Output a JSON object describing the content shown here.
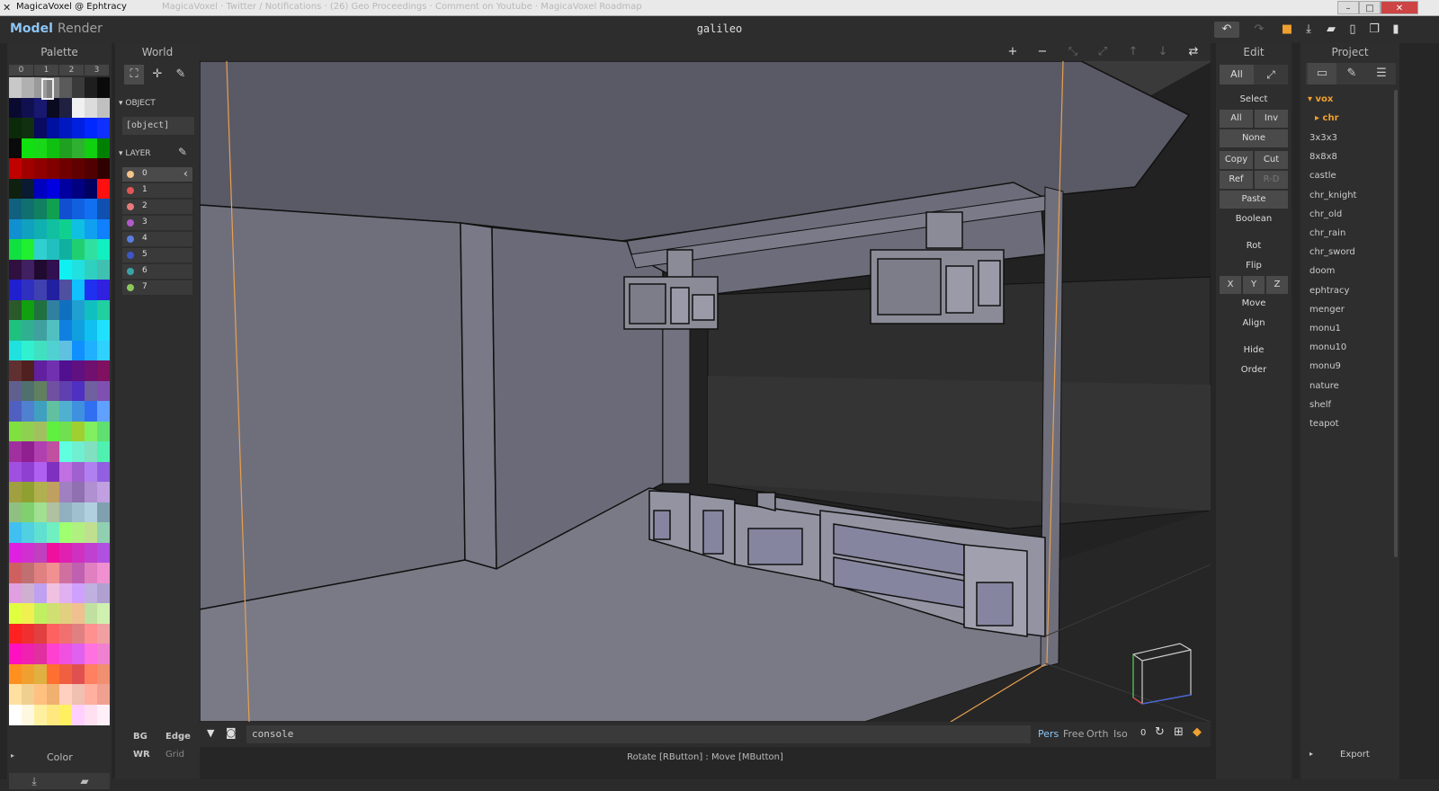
{
  "window": {
    "title": "MagicaVoxel @ Ephtracy",
    "ghost_tabs": "MagicaVoxel  ·  Twitter / Notifications  ·  (26) Geo Proceedings  ·  Comment on Youtube  ·  MagicaVoxel Roadmap",
    "controls": {
      "minimize": "–",
      "maximize": "□",
      "close": "✕"
    }
  },
  "menubar": {
    "tabs": [
      {
        "label": "Model",
        "active": true
      },
      {
        "label": "Render",
        "active": false
      }
    ],
    "document_title": "galileo",
    "right_icons": [
      "undo-icon",
      "redo-icon",
      "save-icon",
      "save-as-icon",
      "open-icon",
      "new-file-icon",
      "copy-file-icon",
      "delete-icon"
    ]
  },
  "palette": {
    "title": "Palette",
    "tabs": [
      "0",
      "1",
      "2",
      "3"
    ],
    "selected_index": 2,
    "footer": {
      "label": "Color"
    }
  },
  "world": {
    "title": "World",
    "object_section": "OBJECT",
    "object_name": "[object]",
    "layer_section": "LAYER",
    "layers": [
      {
        "name": "0",
        "color": "#f5c48a"
      },
      {
        "name": "1",
        "color": "#e25555"
      },
      {
        "name": "2",
        "color": "#e87a7a"
      },
      {
        "name": "3",
        "color": "#b05ac8"
      },
      {
        "name": "4",
        "color": "#5a7ee0"
      },
      {
        "name": "5",
        "color": "#3f56c8"
      },
      {
        "name": "6",
        "color": "#3aa3a8"
      },
      {
        "name": "7",
        "color": "#8ac85a"
      }
    ],
    "footer": {
      "bg": "BG",
      "edge": "Edge",
      "wr": "WR",
      "grid": "Grid"
    }
  },
  "viewport": {
    "console_placeholder": "console",
    "camera_modes": [
      "Pers",
      "Free",
      "Orth",
      "Iso"
    ],
    "active_camera": "Pers",
    "fov": "0",
    "status": "Rotate [RButton] : Move [MButton]"
  },
  "edit": {
    "title": "Edit",
    "mode_all": "All",
    "select_label": "Select",
    "buttons": {
      "all": "All",
      "inv": "Inv",
      "none": "None",
      "copy": "Copy",
      "cut": "Cut",
      "ref": "Ref",
      "rd": "R-D",
      "paste": "Paste"
    },
    "boolean": "Boolean",
    "rot": "Rot",
    "flip": "Flip",
    "axes": [
      "X",
      "Y",
      "Z"
    ],
    "move": "Move",
    "align": "Align",
    "hide": "Hide",
    "order": "Order"
  },
  "project": {
    "title": "Project",
    "folder": "vox",
    "subfolder": "chr",
    "items": [
      "3x3x3",
      "8x8x8",
      "castle",
      "chr_knight",
      "chr_old",
      "chr_rain",
      "chr_sword",
      "doom",
      "ephtracy",
      "menger",
      "monu1",
      "monu10",
      "monu9",
      "nature",
      "shelf",
      "teapot"
    ],
    "export": "Export"
  },
  "colors": {
    "accent_blue": "#8cc5f5",
    "accent_orange": "#f0a030",
    "panel_bg": "#2e2e2e",
    "button_bg": "#4a4a4a"
  }
}
